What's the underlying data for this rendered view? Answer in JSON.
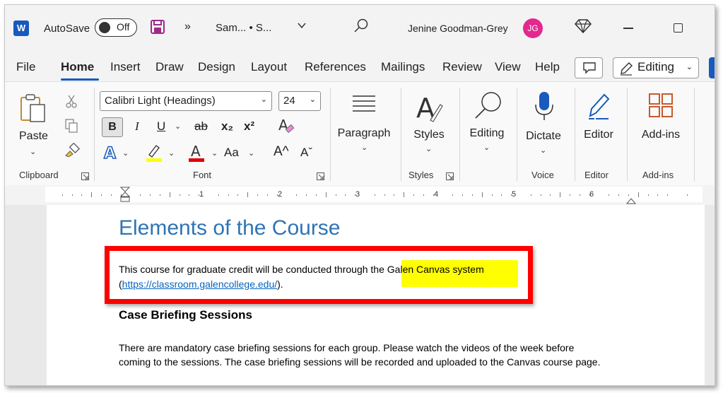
{
  "titlebar": {
    "app_logo": "W",
    "autosave_label": "AutoSave",
    "autosave_state": "Off",
    "more_label": "»",
    "doc_title": "Sam... • S...",
    "user_name": "Jenine Goodman-Grey",
    "avatar_initials": "JG"
  },
  "tabs": [
    "File",
    "Home",
    "Insert",
    "Draw",
    "Design",
    "Layout",
    "References",
    "Mailings",
    "Review",
    "View",
    "Help"
  ],
  "editing_mode": "Editing",
  "ribbon": {
    "clipboard": {
      "paste_label": "Paste",
      "group_label": "Clipboard"
    },
    "font": {
      "font_name": "Calibri Light (Headings)",
      "font_size": "24",
      "bold": "B",
      "italic": "I",
      "underline": "U",
      "strike": "ab",
      "subscript": "x₂",
      "superscript": "x²",
      "change_case": "Aa",
      "grow": "A^",
      "shrink": "Aˇ",
      "group_label": "Font"
    },
    "paragraph": {
      "label": "Paragraph"
    },
    "styles": {
      "label": "Styles",
      "group_label": "Styles"
    },
    "editing": {
      "label": "Editing"
    },
    "voice": {
      "label": "Dictate",
      "group_label": "Voice"
    },
    "editor": {
      "label": "Editor",
      "group_label": "Editor"
    },
    "addins": {
      "label": "Add-ins",
      "group_label": "Add-ins"
    }
  },
  "ruler": {
    "numbers": [
      "1",
      "2",
      "3",
      "4",
      "5",
      "6"
    ]
  },
  "document": {
    "heading": "Elements of the Course",
    "p1_text": "This course for graduate credit will be conducted through the ",
    "p1_highlight": "Galen Canvas system",
    "p1_link_open": "(",
    "p1_link": "https://classroom.galencollege.edu/",
    "p1_link_close": ").",
    "subheading": "Case Briefing Sessions",
    "p2_line1": "There are mandatory case briefing sessions for each group. Please watch the videos of the week before",
    "p2_line2": "coming to the sessions. The case briefing sessions will be recorded and uploaded to the Canvas course page."
  },
  "colors": {
    "accent": "#185abd",
    "heading": "#2e74b5",
    "highlight": "#ffff00",
    "annotation": "#ff0000",
    "avatar": "#e3288f"
  }
}
